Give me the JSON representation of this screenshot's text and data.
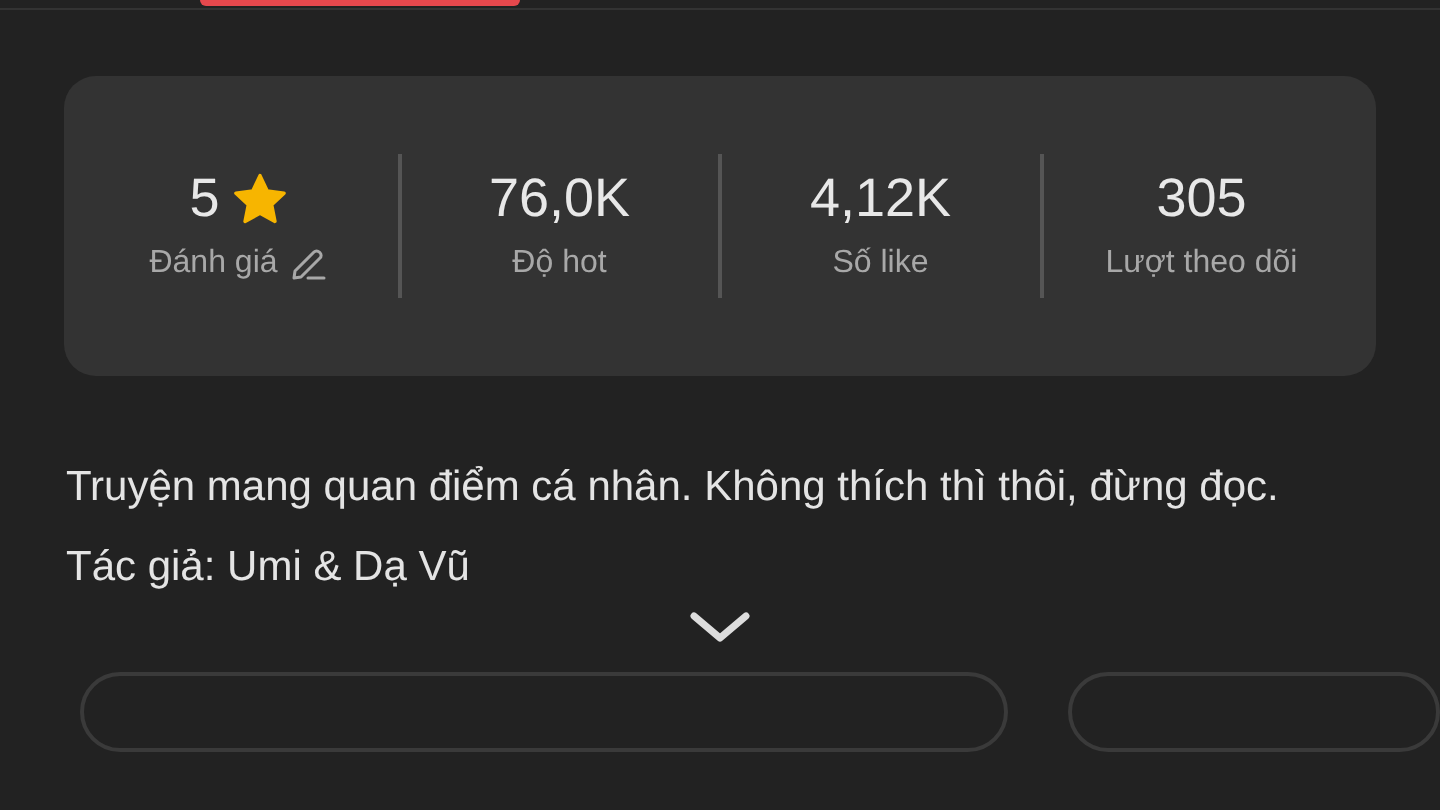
{
  "stats": [
    {
      "kind": "rating",
      "value": "5",
      "label": "Đánh giá"
    },
    {
      "kind": "plain",
      "value": "76,0K",
      "label": "Độ hot"
    },
    {
      "kind": "plain",
      "value": "4,12K",
      "label": "Số like"
    },
    {
      "kind": "plain",
      "value": "305",
      "label": "Lượt theo dõi"
    }
  ],
  "description": "Truyện mang quan điểm cá nhân. Không thích thì thôi, đừng đọc.",
  "author": "Tác giả: Umi & Dạ Vũ"
}
